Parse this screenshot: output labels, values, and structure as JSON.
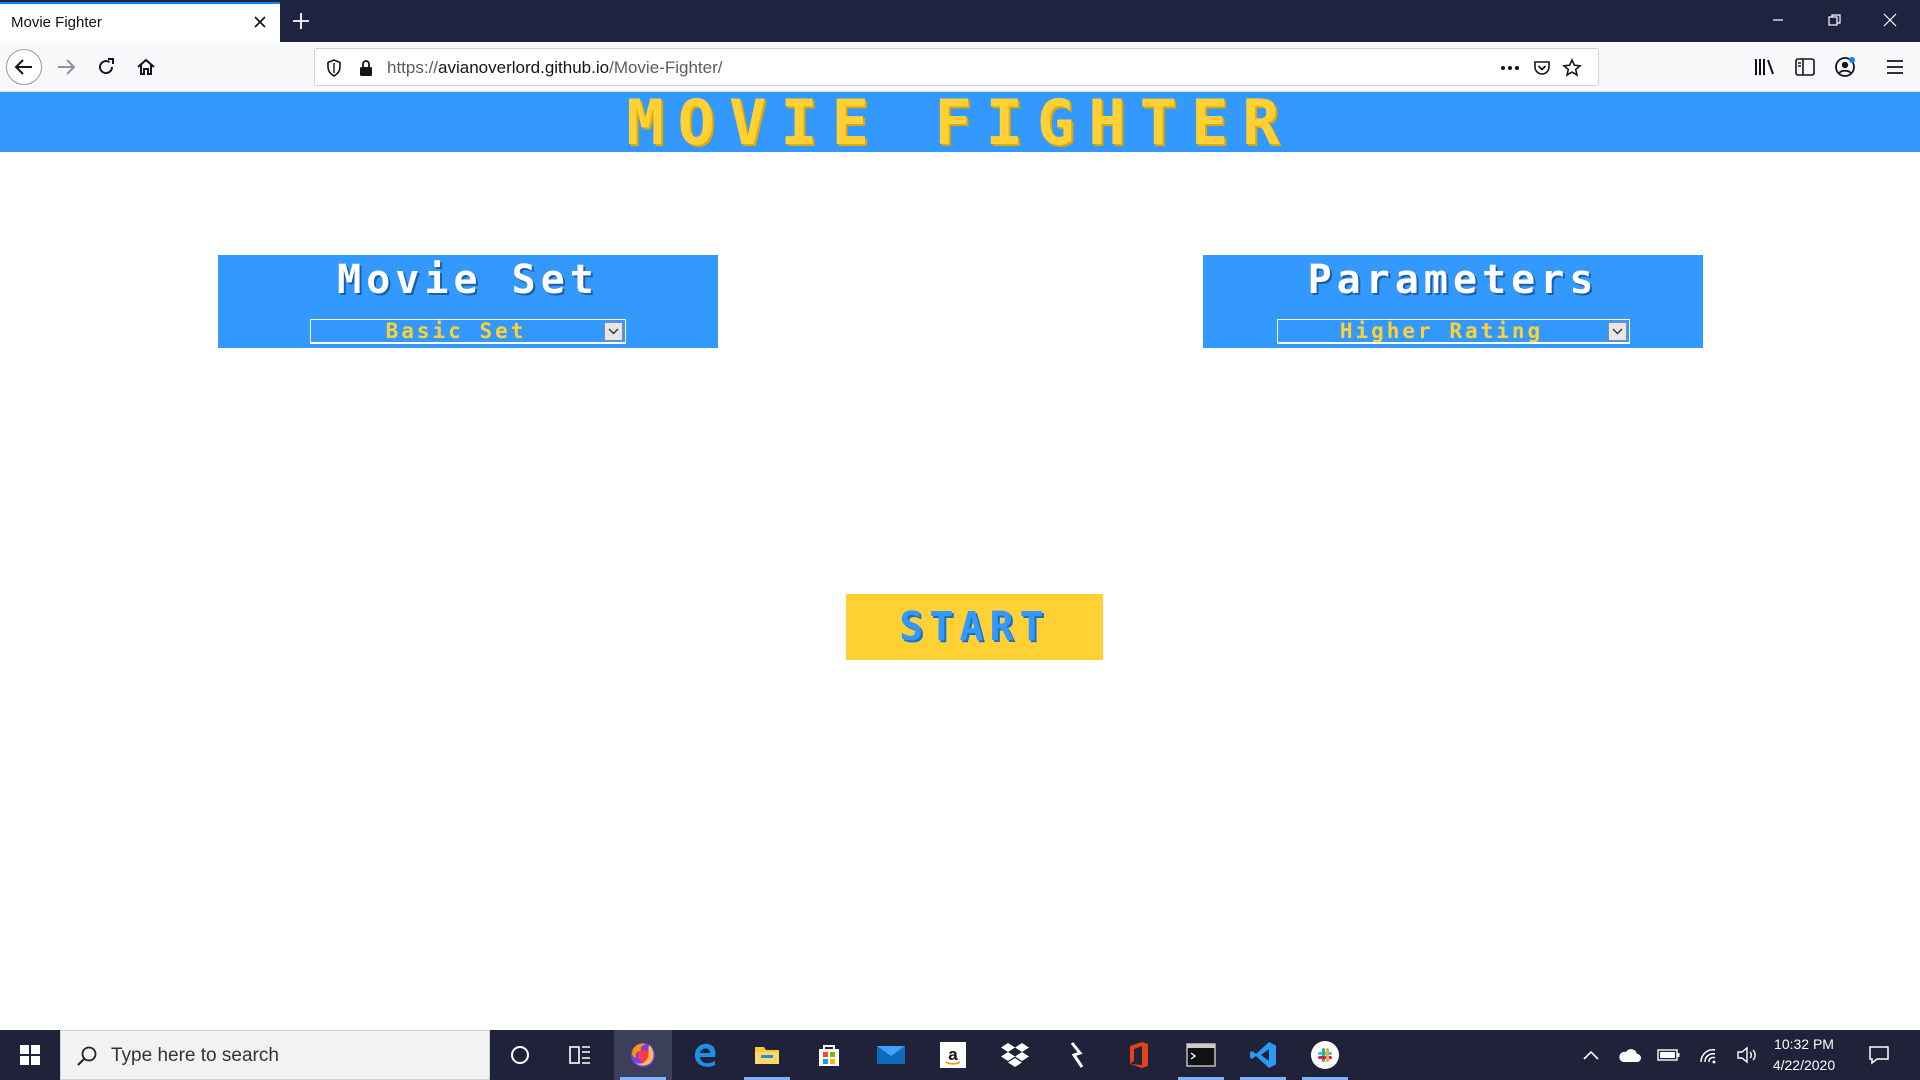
{
  "browser": {
    "tab_title": "Movie Fighter",
    "url_prefix": "https://",
    "url_host": "avianoverlord.github.io",
    "url_path": "/Movie-Fighter/"
  },
  "page": {
    "title": "MOVIE FIGHTER",
    "movie_set": {
      "label": "Movie Set",
      "selected": "Basic Set"
    },
    "parameters": {
      "label": "Parameters",
      "selected": "Higher Rating"
    },
    "start_label": "START"
  },
  "taskbar": {
    "search_placeholder": "Type here to search",
    "time": "10:32 PM",
    "date": "4/22/2020"
  },
  "colors": {
    "accent_blue": "#3399ff",
    "accent_yellow": "#ffd134"
  }
}
